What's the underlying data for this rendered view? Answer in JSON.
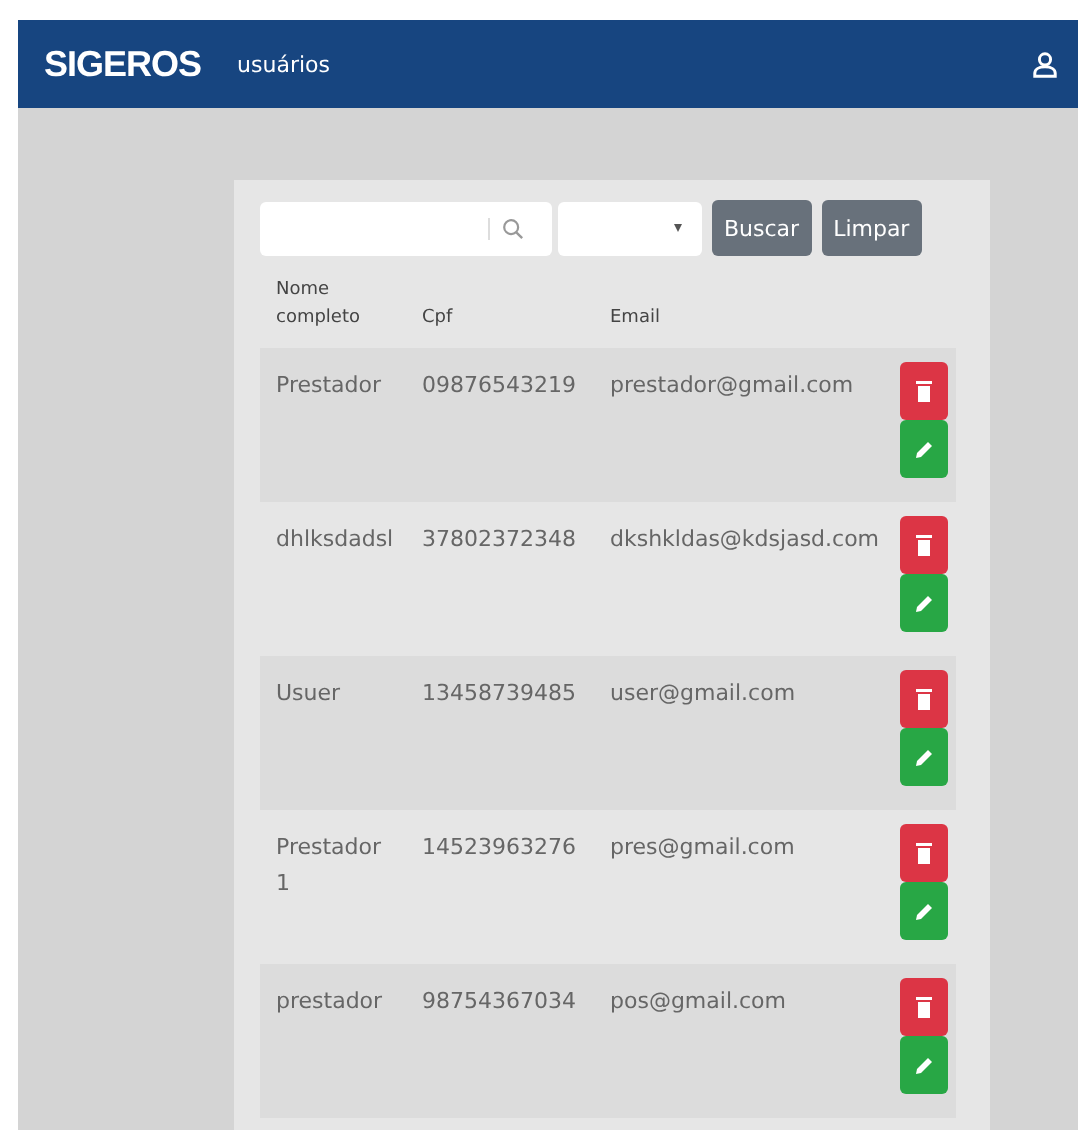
{
  "navbar": {
    "brand": "SIGEROS",
    "link": "usuários"
  },
  "filters": {
    "buttons": [
      "Buscar",
      "Limpar"
    ]
  },
  "table": {
    "columns": [
      "Nome completo",
      "Cpf",
      "Email"
    ],
    "rows": [
      {
        "name": "Prestador",
        "cpf": "09876543219",
        "email": "prestador@gmail.com"
      },
      {
        "name": "dhlksdadsl",
        "cpf": "37802372348",
        "email": "dkshkldas@kdsjasd.com"
      },
      {
        "name": "Usuer",
        "cpf": "13458739485",
        "email": "user@gmail.com"
      },
      {
        "name": "Prestador 1",
        "cpf": "14523963276",
        "email": "pres@gmail.com"
      },
      {
        "name": "prestador",
        "cpf": "98754367034",
        "email": "pos@gmail.com"
      }
    ]
  }
}
